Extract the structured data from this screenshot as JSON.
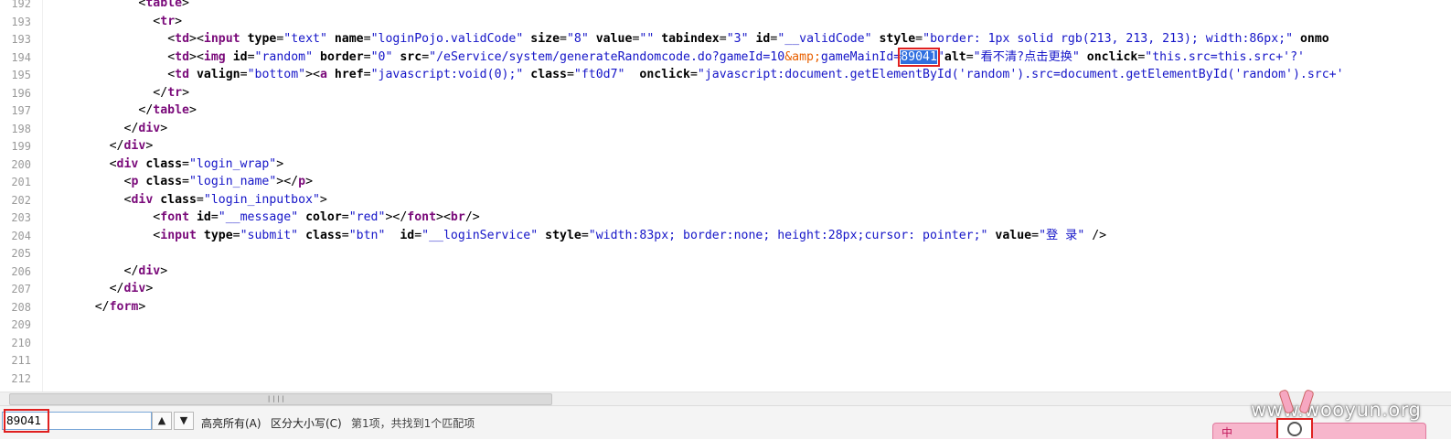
{
  "editor": {
    "lines": [
      {
        "num": "192",
        "indent": 12,
        "tokens": [
          [
            "punct",
            "<"
          ],
          [
            "tag",
            "table"
          ],
          [
            "punct",
            ">"
          ]
        ]
      },
      {
        "num": "193",
        "indent": 14,
        "tokens": [
          [
            "punct",
            "<"
          ],
          [
            "tag",
            "tr"
          ],
          [
            "punct",
            ">"
          ]
        ]
      },
      {
        "num": "193",
        "indent": 16,
        "tokens": [
          [
            "punct",
            "<"
          ],
          [
            "tag",
            "td"
          ],
          [
            "punct",
            "><"
          ],
          [
            "tag",
            "input"
          ],
          [
            "attr",
            " type"
          ],
          [
            "punct",
            "="
          ],
          [
            "val",
            "\"text\""
          ],
          [
            "attr",
            " name"
          ],
          [
            "punct",
            "="
          ],
          [
            "val",
            "\"loginPojo.validCode\""
          ],
          [
            "attr",
            " size"
          ],
          [
            "punct",
            "="
          ],
          [
            "val",
            "\"8\""
          ],
          [
            "attr",
            " value"
          ],
          [
            "punct",
            "="
          ],
          [
            "val",
            "\"\""
          ],
          [
            "attr",
            " tabindex"
          ],
          [
            "punct",
            "="
          ],
          [
            "val",
            "\"3\""
          ],
          [
            "attr",
            " id"
          ],
          [
            "punct",
            "="
          ],
          [
            "val",
            "\"__validCode\""
          ],
          [
            "attr",
            " style"
          ],
          [
            "punct",
            "="
          ],
          [
            "val",
            "\"border: 1px solid rgb(213, 213, 213); width:86px;\""
          ],
          [
            "attr",
            " onmo"
          ]
        ]
      },
      {
        "num": "194",
        "indent": 16,
        "tokens": [
          [
            "punct",
            "<"
          ],
          [
            "tag",
            "td"
          ],
          [
            "punct",
            "><"
          ],
          [
            "tag",
            "img"
          ],
          [
            "attr",
            " id"
          ],
          [
            "punct",
            "="
          ],
          [
            "val",
            "\"random\""
          ],
          [
            "attr",
            " border"
          ],
          [
            "punct",
            "="
          ],
          [
            "val",
            "\"0\""
          ],
          [
            "attr",
            " src"
          ],
          [
            "punct",
            "="
          ],
          [
            "val",
            "\"/eService/system/generateRandomcode.do?gameId=10"
          ],
          [
            "ent",
            "&amp;"
          ],
          [
            "val",
            "gameMainId="
          ],
          [
            "hl",
            "89041"
          ],
          [
            "val",
            "\""
          ],
          [
            "attr",
            "alt"
          ],
          [
            "punct",
            "="
          ],
          [
            "val",
            "\"看不清?点击更换\""
          ],
          [
            "attr",
            " onclick"
          ],
          [
            "punct",
            "="
          ],
          [
            "val",
            "\"this.src=this.src+'?'"
          ]
        ]
      },
      {
        "num": "195",
        "indent": 16,
        "tokens": [
          [
            "punct",
            "<"
          ],
          [
            "tag",
            "td"
          ],
          [
            "attr",
            " valign"
          ],
          [
            "punct",
            "="
          ],
          [
            "val",
            "\"bottom\""
          ],
          [
            "punct",
            "><"
          ],
          [
            "tag",
            "a"
          ],
          [
            "attr",
            " href"
          ],
          [
            "punct",
            "="
          ],
          [
            "val",
            "\"javascript:void(0);\""
          ],
          [
            "attr",
            " class"
          ],
          [
            "punct",
            "="
          ],
          [
            "val",
            "\"ft0d7\""
          ],
          [
            "attr",
            "  onclick"
          ],
          [
            "punct",
            "="
          ],
          [
            "val",
            "\"javascript:document.getElementById('random').src=document.getElementById('random').src+'"
          ]
        ]
      },
      {
        "num": "196",
        "indent": 14,
        "tokens": [
          [
            "punct",
            "</"
          ],
          [
            "tag",
            "tr"
          ],
          [
            "punct",
            ">"
          ]
        ]
      },
      {
        "num": "197",
        "indent": 12,
        "tokens": [
          [
            "punct",
            "</"
          ],
          [
            "tag",
            "table"
          ],
          [
            "punct",
            ">"
          ]
        ]
      },
      {
        "num": "198",
        "indent": 10,
        "tokens": [
          [
            "punct",
            "</"
          ],
          [
            "tag",
            "div"
          ],
          [
            "punct",
            ">"
          ]
        ]
      },
      {
        "num": "199",
        "indent": 8,
        "tokens": [
          [
            "punct",
            "</"
          ],
          [
            "tag",
            "div"
          ],
          [
            "punct",
            ">"
          ]
        ]
      },
      {
        "num": "200",
        "indent": 8,
        "tokens": [
          [
            "punct",
            "<"
          ],
          [
            "tag",
            "div"
          ],
          [
            "attr",
            " class"
          ],
          [
            "punct",
            "="
          ],
          [
            "val",
            "\"login_wrap\""
          ],
          [
            "punct",
            ">"
          ]
        ]
      },
      {
        "num": "201",
        "indent": 10,
        "tokens": [
          [
            "punct",
            "<"
          ],
          [
            "tag",
            "p"
          ],
          [
            "attr",
            " class"
          ],
          [
            "punct",
            "="
          ],
          [
            "val",
            "\"login_name\""
          ],
          [
            "punct",
            "></"
          ],
          [
            "tag",
            "p"
          ],
          [
            "punct",
            ">"
          ]
        ]
      },
      {
        "num": "202",
        "indent": 10,
        "tokens": [
          [
            "punct",
            "<"
          ],
          [
            "tag",
            "div"
          ],
          [
            "attr",
            " class"
          ],
          [
            "punct",
            "="
          ],
          [
            "val",
            "\"login_inputbox\""
          ],
          [
            "punct",
            ">"
          ]
        ]
      },
      {
        "num": "203",
        "indent": 14,
        "tokens": [
          [
            "punct",
            "<"
          ],
          [
            "tag",
            "font"
          ],
          [
            "attr",
            " id"
          ],
          [
            "punct",
            "="
          ],
          [
            "val",
            "\"__message\""
          ],
          [
            "attr",
            " color"
          ],
          [
            "punct",
            "="
          ],
          [
            "val",
            "\"red\""
          ],
          [
            "punct",
            "></"
          ],
          [
            "tag",
            "font"
          ],
          [
            "punct",
            "><"
          ],
          [
            "tag",
            "br"
          ],
          [
            "punct",
            "/>"
          ]
        ]
      },
      {
        "num": "204",
        "indent": 14,
        "tokens": [
          [
            "punct",
            "<"
          ],
          [
            "tag",
            "input"
          ],
          [
            "attr",
            " type"
          ],
          [
            "punct",
            "="
          ],
          [
            "val",
            "\"submit\""
          ],
          [
            "attr",
            " class"
          ],
          [
            "punct",
            "="
          ],
          [
            "val",
            "\"btn\""
          ],
          [
            "attr",
            "  id"
          ],
          [
            "punct",
            "="
          ],
          [
            "val",
            "\"__loginService\""
          ],
          [
            "attr",
            " style"
          ],
          [
            "punct",
            "="
          ],
          [
            "val",
            "\"width:83px; border:none; height:28px;cursor: pointer;\""
          ],
          [
            "attr",
            " value"
          ],
          [
            "punct",
            "="
          ],
          [
            "val",
            "\"登 录\""
          ],
          [
            "punct",
            " />"
          ]
        ]
      },
      {
        "num": "205",
        "indent": 0,
        "tokens": []
      },
      {
        "num": "206",
        "indent": 10,
        "tokens": [
          [
            "punct",
            "</"
          ],
          [
            "tag",
            "div"
          ],
          [
            "punct",
            ">"
          ]
        ]
      },
      {
        "num": "207",
        "indent": 8,
        "tokens": [
          [
            "punct",
            "</"
          ],
          [
            "tag",
            "div"
          ],
          [
            "punct",
            ">"
          ]
        ]
      },
      {
        "num": "208",
        "indent": 6,
        "tokens": [
          [
            "punct",
            "</"
          ],
          [
            "tag",
            "form"
          ],
          [
            "punct",
            ">"
          ]
        ]
      },
      {
        "num": "209",
        "indent": 0,
        "tokens": []
      },
      {
        "num": "210",
        "indent": 0,
        "tokens": []
      },
      {
        "num": "211",
        "indent": 0,
        "tokens": []
      },
      {
        "num": "212",
        "indent": 0,
        "tokens": []
      }
    ]
  },
  "findbar": {
    "query": "89041",
    "prev_label": "▲",
    "next_label": "▼",
    "highlight_all": "高亮所有(A)",
    "match_case": "区分大小写(C)",
    "status": "第1项，共找到1个匹配项"
  },
  "watermark": "www.wooyun.org",
  "ime": {
    "label": "中"
  }
}
